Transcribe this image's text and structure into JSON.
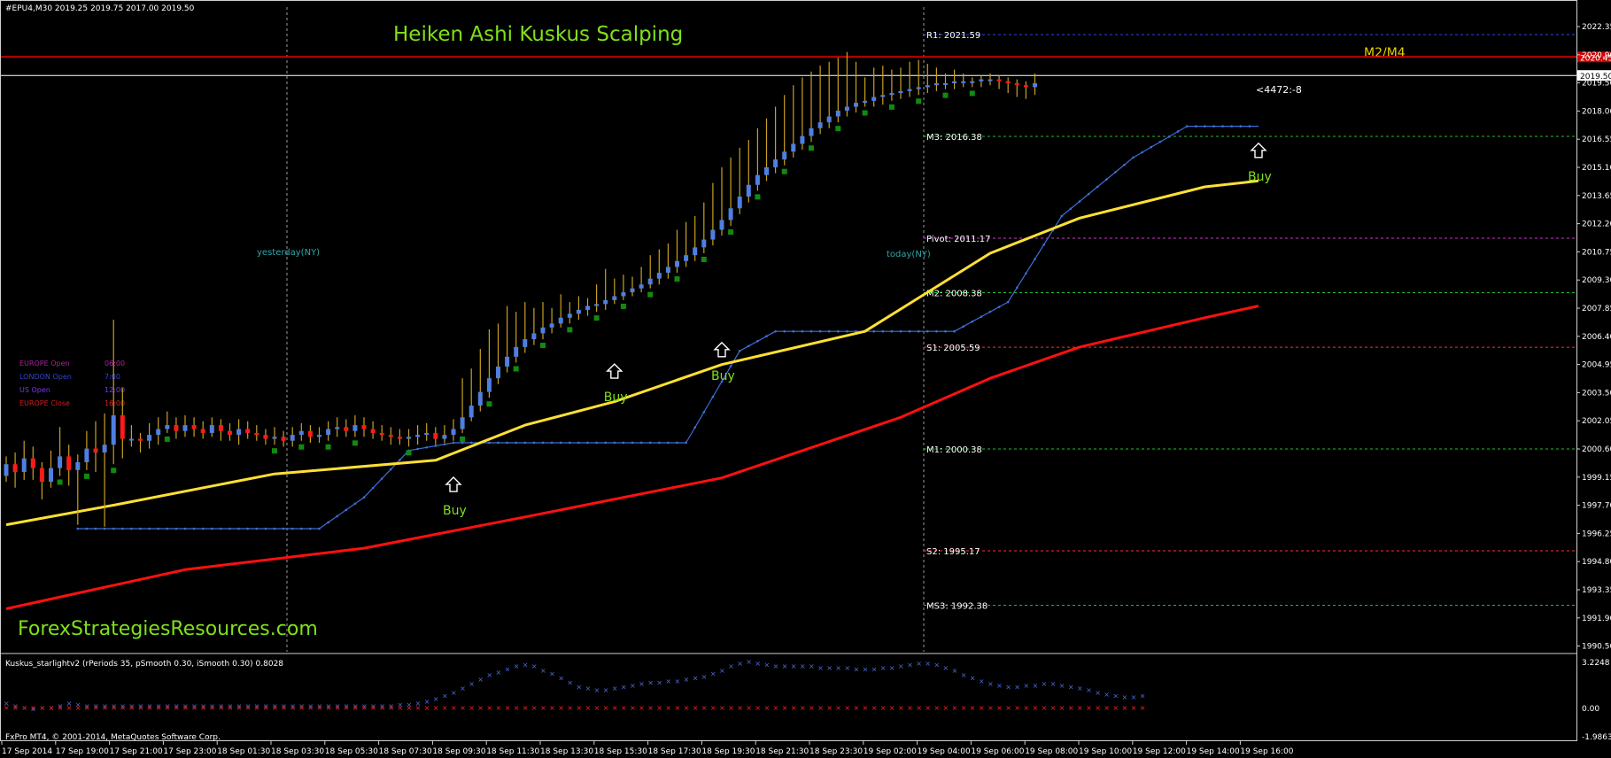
{
  "window": {
    "header": "#EPU4,M30  2019.25 2019.75 2017.00 2019.50",
    "title": "Heiken Ashi Kuskus Scalping",
    "watermark": "ForexStrategiesResources.com",
    "copyright": "FxPro MT4, © 2001-2014, MetaQuotes Software Corp."
  },
  "colors": {
    "background": "#000000",
    "bull_candle": "#4f7fe0",
    "bear_candle": "#ff1a1a",
    "wick": "#c8a020",
    "ma_yellow": "#ffe033",
    "ma_red": "#ff1010",
    "trail_blue": "#3d6fd6",
    "title_green": "#7fe01a",
    "pivot_red": "#ff3030",
    "pivot_green": "#1fbf2a",
    "pivot_magenta": "#cc33cc",
    "pivot_blue": "#3344ee"
  },
  "sessions": [
    {
      "label": "EUROPE Open",
      "time": "06:00",
      "color": "#b0209f"
    },
    {
      "label": "LONDON Open",
      "time": "7:00",
      "color": "#3344cc"
    },
    {
      "label": "US Open",
      "time": "12:00",
      "color": "#7a33ff"
    },
    {
      "label": "EUROPE Close",
      "time": "16:00",
      "color": "#d02020"
    }
  ],
  "chart_data": {
    "type": "candlestick",
    "symbol": "#EPU4,M30",
    "ylim": [
      1990.0,
      2023.0
    ],
    "y_ticks": [
      "2022.35",
      "2020.90",
      "2019.50",
      "2018.00",
      "2016.55",
      "2015.10",
      "2013.65",
      "2012.20",
      "2010.75",
      "2009.30",
      "2007.85",
      "2006.40",
      "2004.95",
      "2003.50",
      "2002.05",
      "2000.60",
      "1999.15",
      "1997.70",
      "1996.25",
      "1994.80",
      "1993.35",
      "1991.90",
      "1990.50"
    ],
    "price_tags": [
      {
        "label": "2020.45",
        "value": 2020.45,
        "color": "#cc0000",
        "text_color": "#ffffff"
      },
      {
        "label": "2019.50",
        "value": 2019.5,
        "color": "#ffffff",
        "text_color": "#000000"
      }
    ],
    "x_ticks": [
      "17 Sep 2014",
      "17 Sep 19:00",
      "17 Sep 21:00",
      "17 Sep 23:00",
      "18 Sep 01:30",
      "18 Sep 03:30",
      "18 Sep 05:30",
      "18 Sep 07:30",
      "18 Sep 09:30",
      "18 Sep 11:30",
      "18 Sep 13:30",
      "18 Sep 15:30",
      "18 Sep 17:30",
      "18 Sep 19:30",
      "18 Sep 21:30",
      "18 Sep 23:30",
      "19 Sep 02:00",
      "19 Sep 04:00",
      "19 Sep 06:00",
      "19 Sep 08:00",
      "19 Sep 10:00",
      "19 Sep 12:00",
      "19 Sep 14:00",
      "19 Sep 16:00"
    ],
    "pivot_levels": [
      {
        "label": "R1: 2021.59",
        "value": 2021.59,
        "color": "#3344ee"
      },
      {
        "label": "M3: 2016.38",
        "value": 2016.38,
        "color": "#1fbf2a"
      },
      {
        "label": "Pivot: 2011.17",
        "value": 2011.17,
        "color": "#cc33cc"
      },
      {
        "label": "M2: 2008.38",
        "value": 2008.38,
        "color": "#1fbf2a"
      },
      {
        "label": "S1: 2005.59",
        "value": 2005.59,
        "color": "#ff3030"
      },
      {
        "label": "M1: 2000.38",
        "value": 2000.38,
        "color": "#1fbf2a"
      },
      {
        "label": "S2: 1995.17",
        "value": 1995.17,
        "color": "#ff3030"
      },
      {
        "label": "MS3: 1992.38",
        "value": 1992.38,
        "color": "#1fbf2a"
      }
    ],
    "zone_label": "M2/M4",
    "day_labels": [
      "yesterday(NY)",
      "today(NY)"
    ],
    "countdown": "<4472:-8",
    "signals": [
      {
        "label": "Buy",
        "bar": 50,
        "price": 1999.2
      },
      {
        "label": "Buy",
        "bar": 68,
        "price": 2005.0
      },
      {
        "label": "Buy",
        "bar": 80,
        "price": 2006.1
      },
      {
        "label": "Buy",
        "bar": 140,
        "price": 2016.3
      }
    ],
    "series": [
      {
        "name": "Heiken Ashi",
        "kind": "candles",
        "bars": [
          [
            0.0,
            0.6,
            -0.3,
            1.0
          ],
          [
            0.6,
            0.2,
            -0.6,
            1.2
          ],
          [
            0.2,
            0.9,
            -0.2,
            1.8
          ],
          [
            0.9,
            0.4,
            -0.2,
            1.5
          ],
          [
            0.4,
            -0.3,
            -1.2,
            0.7
          ],
          [
            -0.3,
            0.4,
            -0.6,
            1.3
          ],
          [
            0.4,
            1.0,
            0.0,
            2.5
          ],
          [
            1.0,
            0.3,
            -0.5,
            1.6
          ],
          [
            0.3,
            0.7,
            -2.5,
            1.1
          ],
          [
            0.7,
            1.4,
            0.3,
            2.3
          ],
          [
            1.4,
            1.2,
            0.2,
            2.8
          ],
          [
            1.2,
            1.6,
            -2.6,
            3.2
          ],
          [
            1.6,
            3.1,
            0.6,
            8.0
          ],
          [
            3.1,
            1.9,
            0.9,
            4.5
          ],
          [
            1.9,
            1.9,
            1.5,
            2.6
          ],
          [
            1.9,
            1.8,
            1.2,
            2.2
          ],
          [
            1.8,
            2.1,
            1.4,
            2.7
          ],
          [
            2.1,
            2.4,
            1.6,
            3.0
          ],
          [
            2.4,
            2.6,
            2.2,
            3.3
          ],
          [
            2.6,
            2.3,
            1.9,
            3.0
          ],
          [
            2.3,
            2.6,
            2.0,
            3.1
          ],
          [
            2.6,
            2.4,
            2.0,
            3.0
          ],
          [
            2.4,
            2.2,
            1.9,
            2.8
          ],
          [
            2.2,
            2.6,
            2.0,
            3.0
          ],
          [
            2.6,
            2.3,
            1.8,
            2.9
          ],
          [
            2.3,
            2.1,
            1.8,
            2.7
          ],
          [
            2.1,
            2.4,
            1.6,
            2.9
          ],
          [
            2.4,
            2.2,
            1.9,
            2.8
          ],
          [
            2.2,
            2.1,
            1.8,
            2.6
          ],
          [
            2.1,
            1.9,
            1.6,
            2.4
          ],
          [
            1.9,
            2.0,
            1.6,
            2.5
          ],
          [
            2.0,
            1.8,
            1.5,
            2.3
          ],
          [
            1.8,
            2.1,
            1.5,
            2.5
          ],
          [
            2.1,
            2.3,
            1.8,
            2.7
          ],
          [
            2.3,
            2.0,
            1.7,
            2.6
          ],
          [
            2.0,
            2.1,
            1.7,
            2.5
          ],
          [
            2.1,
            2.4,
            1.8,
            2.8
          ],
          [
            2.4,
            2.5,
            2.0,
            3.0
          ],
          [
            2.5,
            2.3,
            2.0,
            2.9
          ],
          [
            2.3,
            2.6,
            2.0,
            3.1
          ],
          [
            2.6,
            2.4,
            2.0,
            3.0
          ],
          [
            2.4,
            2.2,
            1.9,
            2.8
          ],
          [
            2.2,
            2.1,
            1.8,
            2.6
          ],
          [
            2.1,
            2.0,
            1.6,
            2.5
          ],
          [
            2.0,
            1.9,
            1.6,
            2.4
          ],
          [
            1.9,
            2.0,
            1.5,
            2.4
          ],
          [
            2.0,
            2.1,
            1.6,
            2.6
          ],
          [
            2.1,
            2.2,
            1.8,
            2.7
          ],
          [
            2.2,
            1.9,
            1.6,
            2.5
          ],
          [
            1.9,
            2.1,
            1.7,
            2.6
          ],
          [
            2.1,
            2.4,
            1.8,
            2.9
          ],
          [
            2.4,
            3.0,
            2.2,
            5.0
          ],
          [
            3.0,
            3.6,
            2.8,
            5.5
          ],
          [
            3.6,
            4.3,
            3.3,
            6.5
          ],
          [
            4.3,
            5.0,
            4.0,
            7.5
          ],
          [
            5.0,
            5.6,
            4.7,
            7.8
          ],
          [
            5.6,
            6.1,
            5.3,
            8.7
          ],
          [
            6.1,
            6.6,
            5.8,
            8.4
          ],
          [
            6.6,
            7.0,
            6.3,
            8.9
          ],
          [
            7.0,
            7.3,
            6.7,
            8.6
          ],
          [
            7.3,
            7.6,
            7.0,
            8.9
          ],
          [
            7.6,
            7.8,
            7.3,
            8.6
          ],
          [
            7.8,
            8.1,
            7.6,
            9.3
          ],
          [
            8.1,
            8.3,
            7.8,
            8.9
          ],
          [
            8.3,
            8.5,
            8.0,
            9.2
          ],
          [
            8.5,
            8.7,
            8.2,
            9.1
          ],
          [
            8.7,
            8.8,
            8.4,
            9.8
          ],
          [
            8.8,
            9.0,
            8.5,
            10.6
          ],
          [
            9.0,
            9.2,
            8.8,
            10.1
          ],
          [
            9.2,
            9.4,
            9.0,
            10.3
          ],
          [
            9.4,
            9.6,
            9.2,
            10.2
          ],
          [
            9.6,
            9.8,
            9.4,
            10.7
          ],
          [
            9.8,
            10.1,
            9.6,
            11.3
          ],
          [
            10.1,
            10.4,
            9.8,
            11.6
          ],
          [
            10.4,
            10.7,
            10.1,
            11.9
          ],
          [
            10.7,
            11.0,
            10.4,
            12.6
          ],
          [
            11.0,
            11.3,
            10.7,
            13.0
          ],
          [
            11.3,
            11.7,
            11.0,
            13.3
          ],
          [
            11.7,
            12.1,
            11.4,
            14.0
          ],
          [
            12.1,
            12.6,
            11.8,
            15.0
          ],
          [
            12.6,
            13.1,
            12.3,
            15.8
          ],
          [
            13.1,
            13.7,
            12.8,
            16.3
          ],
          [
            13.7,
            14.3,
            13.4,
            16.8
          ],
          [
            14.3,
            14.9,
            14.0,
            17.2
          ],
          [
            14.9,
            15.4,
            14.6,
            17.8
          ],
          [
            15.4,
            15.8,
            15.1,
            18.3
          ],
          [
            15.8,
            16.2,
            15.5,
            18.9
          ],
          [
            16.2,
            16.6,
            15.9,
            19.5
          ],
          [
            16.6,
            17.0,
            16.3,
            20.0
          ],
          [
            17.0,
            17.4,
            16.7,
            20.4
          ],
          [
            17.4,
            17.8,
            17.1,
            20.7
          ],
          [
            17.8,
            18.1,
            17.5,
            21.0
          ],
          [
            18.1,
            18.4,
            17.8,
            21.2
          ],
          [
            18.4,
            18.7,
            18.1,
            21.4
          ],
          [
            18.7,
            18.9,
            18.4,
            21.7
          ],
          [
            18.9,
            19.1,
            18.6,
            21.2
          ],
          [
            19.1,
            19.2,
            18.9,
            20.4
          ],
          [
            19.2,
            19.4,
            18.9,
            20.9
          ],
          [
            19.4,
            19.5,
            19.0,
            21.0
          ],
          [
            19.5,
            19.6,
            19.2,
            20.8
          ],
          [
            19.6,
            19.7,
            19.3,
            20.9
          ],
          [
            19.7,
            19.8,
            19.4,
            21.2
          ],
          [
            19.8,
            19.9,
            19.5,
            21.3
          ],
          [
            19.9,
            20.0,
            19.6,
            21.1
          ],
          [
            20.0,
            20.1,
            19.7,
            20.9
          ],
          [
            20.1,
            20.1,
            19.8,
            20.6
          ],
          [
            20.1,
            20.2,
            19.8,
            20.8
          ],
          [
            20.2,
            20.2,
            19.9,
            20.6
          ],
          [
            20.2,
            20.2,
            19.9,
            20.4
          ],
          [
            20.2,
            20.3,
            19.9,
            20.5
          ],
          [
            20.3,
            20.3,
            20.0,
            20.6
          ],
          [
            20.3,
            20.2,
            19.8,
            20.5
          ],
          [
            20.2,
            20.1,
            19.6,
            20.4
          ],
          [
            20.1,
            20.0,
            19.4,
            20.3
          ],
          [
            20.0,
            19.9,
            19.3,
            20.2
          ],
          [
            19.9,
            20.1,
            19.5,
            20.6
          ]
        ]
      },
      {
        "name": "MA yellow",
        "kind": "line",
        "points": [
          [
            0,
            1996.5
          ],
          [
            12,
            1997.5
          ],
          [
            30,
            1999.1
          ],
          [
            48,
            1999.8
          ],
          [
            58,
            2001.6
          ],
          [
            68,
            2002.8
          ],
          [
            80,
            2004.7
          ],
          [
            96,
            2006.4
          ],
          [
            110,
            2010.4
          ],
          [
            120,
            2012.2
          ],
          [
            134,
            2013.8
          ],
          [
            140,
            2014.1
          ]
        ]
      },
      {
        "name": "MA red",
        "kind": "line",
        "points": [
          [
            0,
            1992.2
          ],
          [
            20,
            1994.2
          ],
          [
            40,
            1995.3
          ],
          [
            58,
            1996.9
          ],
          [
            80,
            1998.9
          ],
          [
            100,
            2002.0
          ],
          [
            110,
            2004.0
          ],
          [
            120,
            2005.6
          ],
          [
            134,
            2007.1
          ],
          [
            140,
            2007.7
          ]
        ]
      },
      {
        "name": "Trail stop",
        "kind": "trail",
        "points": [
          [
            8,
            1996.3
          ],
          [
            35,
            1996.3
          ],
          [
            40,
            1997.9
          ],
          [
            45,
            2000.3
          ],
          [
            50,
            2000.7
          ],
          [
            76,
            2000.7
          ],
          [
            82,
            2005.4
          ],
          [
            86,
            2006.4
          ],
          [
            106,
            2006.4
          ],
          [
            112,
            2007.9
          ],
          [
            118,
            2012.3
          ],
          [
            126,
            2015.3
          ],
          [
            132,
            2016.9
          ],
          [
            140,
            2016.9
          ]
        ]
      }
    ],
    "indicator": {
      "title": "Kuskus_starlightv2  (rPeriods 35, pSmooth 0.30, iSmooth 0.30)  0.8028",
      "ylim": [
        -1.9863,
        3.2248
      ],
      "y_ticks": [
        "3.2248",
        "0.00",
        "-1.9863"
      ],
      "blue_values": [
        0.3,
        0.1,
        0.0,
        -0.1,
        0.0,
        0.0,
        0.1,
        0.3,
        0.2,
        0.1,
        0.1,
        0.1,
        0.1,
        0.1,
        0.1,
        0.1,
        0.1,
        0.1,
        0.1,
        0.1,
        0.1,
        0.1,
        0.1,
        0.1,
        0.1,
        0.1,
        0.1,
        0.1,
        0.1,
        0.1,
        0.1,
        0.1,
        0.1,
        0.1,
        0.1,
        0.1,
        0.1,
        0.1,
        0.1,
        0.1,
        0.1,
        0.1,
        0.1,
        0.1,
        0.2,
        0.2,
        0.3,
        0.4,
        0.6,
        0.8,
        1.0,
        1.3,
        1.6,
        1.9,
        2.2,
        2.4,
        2.6,
        2.8,
        2.9,
        2.8,
        2.5,
        2.3,
        2.0,
        1.7,
        1.4,
        1.3,
        1.2,
        1.2,
        1.3,
        1.4,
        1.5,
        1.6,
        1.7,
        1.7,
        1.8,
        1.8,
        1.9,
        2.0,
        2.1,
        2.3,
        2.5,
        2.8,
        3.0,
        3.1,
        3.0,
        2.9,
        2.8,
        2.8,
        2.8,
        2.8,
        2.8,
        2.7,
        2.7,
        2.7,
        2.7,
        2.6,
        2.6,
        2.6,
        2.7,
        2.7,
        2.8,
        2.9,
        3.0,
        3.0,
        2.9,
        2.7,
        2.5,
        2.2,
        2.0,
        1.8,
        1.6,
        1.5,
        1.4,
        1.4,
        1.5,
        1.5,
        1.6,
        1.6,
        1.5,
        1.4,
        1.3,
        1.2,
        1.0,
        0.9,
        0.8,
        0.7,
        0.7,
        0.8
      ]
    }
  }
}
